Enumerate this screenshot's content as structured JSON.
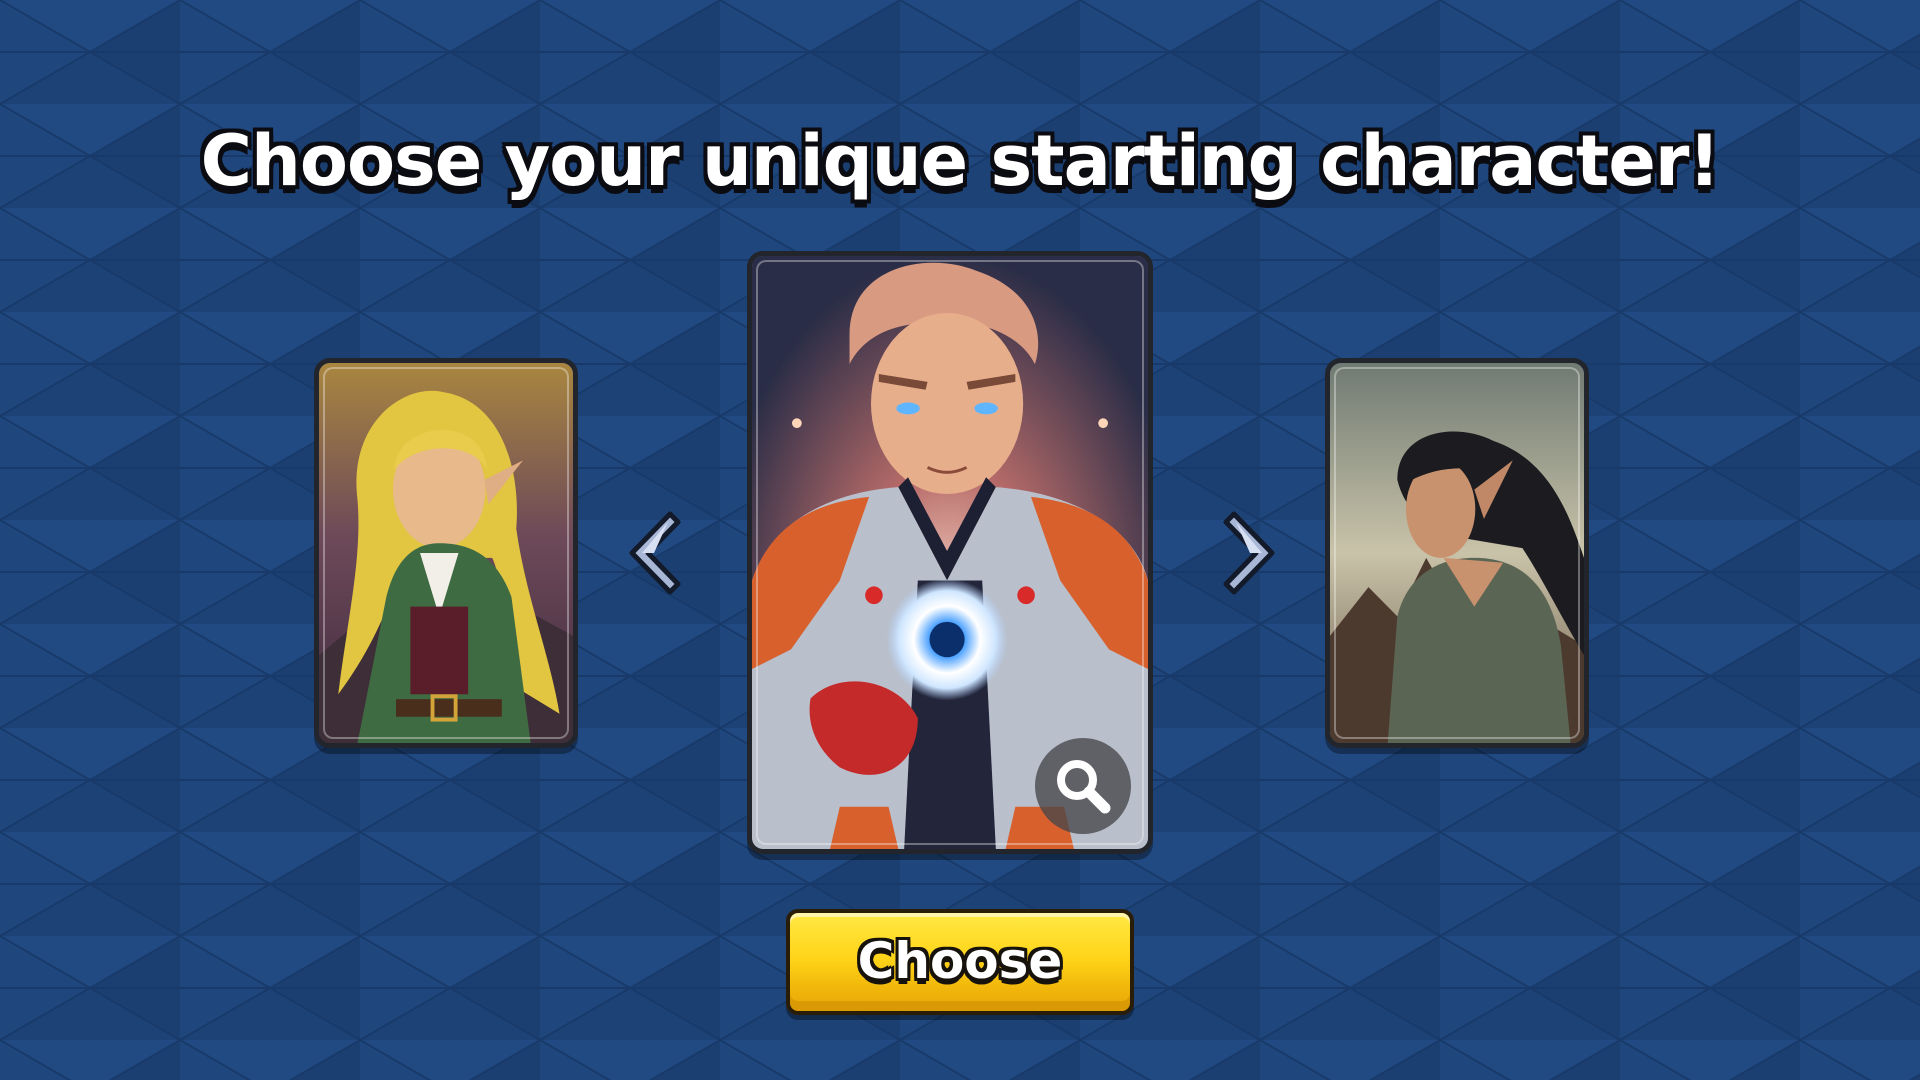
{
  "screen": {
    "title": "Choose your unique starting character!",
    "choose_button_label": "Choose"
  },
  "carousel": {
    "previous_arrow_icon": "chevron-left-icon",
    "next_arrow_icon": "chevron-right-icon",
    "zoom_icon": "magnifier-icon",
    "cards": [
      {
        "slot": "left",
        "portrait": "blonde-elf-in-green-coat"
      },
      {
        "slot": "center",
        "portrait": "armored-hero-with-glowing-orb",
        "selected": true
      },
      {
        "slot": "right",
        "portrait": "dark-haired-elf-in-green-shirt"
      }
    ]
  },
  "colors": {
    "background": "#1d4276",
    "button_yellow": "#ffd51a",
    "card_border": "#23252c",
    "title_text": "#ffffff"
  }
}
